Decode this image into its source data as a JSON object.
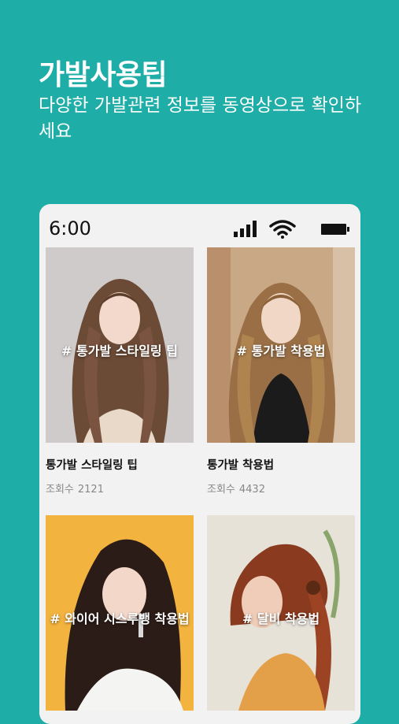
{
  "header": {
    "title": "가발사용팁",
    "subtitle": "다양한 가발관련 정보를 동영상으로 확인하세요"
  },
  "status_bar": {
    "time": "6:00",
    "icons": [
      "signal-icon",
      "wifi-icon",
      "battery-icon"
    ]
  },
  "colors": {
    "background": "#1fada7",
    "card_bg": "#f2f2f2"
  },
  "videos": [
    {
      "tag": "# 통가발 스타일링 팁",
      "title": "통가발 스타일링 팁",
      "views_label": "조회수",
      "views": "2121"
    },
    {
      "tag": "# 통가발 착용법",
      "title": "통가발 착용법",
      "views_label": "조회수",
      "views": "4432"
    },
    {
      "tag": "# 와이어 시스루뱅 착용법",
      "title": "",
      "views_label": "",
      "views": ""
    },
    {
      "tag": "# 달비 착용법",
      "title": "",
      "views_label": "",
      "views": ""
    }
  ]
}
